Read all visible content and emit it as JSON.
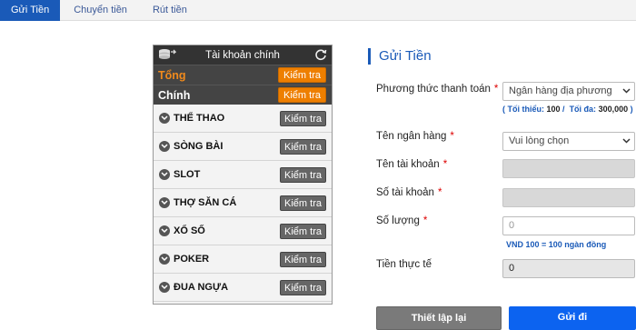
{
  "tabs": [
    {
      "label": "Gửi Tiền",
      "active": true
    },
    {
      "label": "Chuyển tiền",
      "active": false
    },
    {
      "label": "Rút tiền",
      "active": false
    }
  ],
  "wallet": {
    "title": "Tài khoản chính",
    "total_label": "Tổng",
    "main_label": "Chính",
    "check_label": "Kiểm tra",
    "games": [
      {
        "name": "THỂ THAO"
      },
      {
        "name": "SÒNG BÀI"
      },
      {
        "name": "SLOT"
      },
      {
        "name": "THỢ SĂN CÁ"
      },
      {
        "name": "XỔ SỐ"
      },
      {
        "name": "POKER"
      },
      {
        "name": "ĐUA NGỰA"
      }
    ]
  },
  "form": {
    "title": "Gửi Tiền",
    "payment_method_label": "Phương thức thanh toán",
    "payment_method_value": "Ngân hàng địa phương",
    "limits_min_label": "Tối thiểu:",
    "limits_min_value": "100",
    "limits_max_label": "Tối đa:",
    "limits_max_value": "300,000",
    "bank_name_label": "Tên ngân hàng",
    "bank_name_value": "Vui lòng chọn",
    "account_name_label": "Tên tài khoản",
    "account_number_label": "Số tài khoản",
    "amount_label": "Số lượng",
    "amount_placeholder": "0",
    "rate_note": "VND 100 = 100 ngàn đồng",
    "actual_label": "Tiền thực tế",
    "actual_value": "0",
    "reset_label": "Thiết lập lại",
    "submit_label": "Gửi đi"
  },
  "colors": {
    "accent": "#1a5ab8",
    "orange": "#ee7f00",
    "submit": "#0c63f0"
  }
}
